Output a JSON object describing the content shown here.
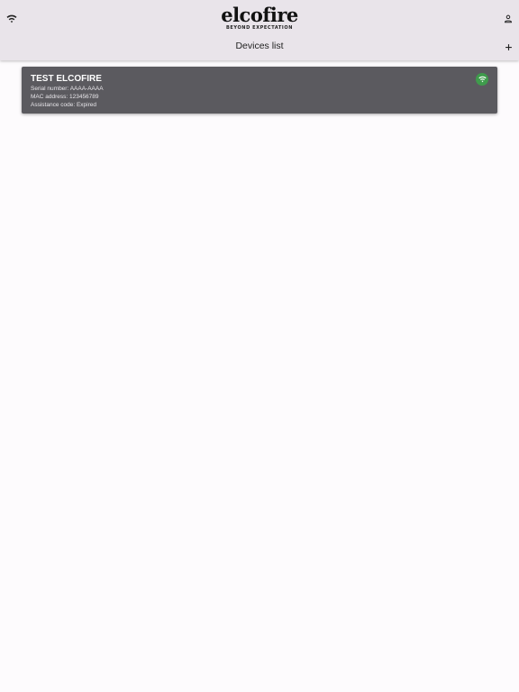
{
  "header": {
    "logo_text": "elcofire",
    "logo_tagline": "BEYOND EXPECTATION",
    "page_title": "Devices list",
    "icons": {
      "left": "wifi-icon",
      "right": "person-icon",
      "action": "plus-icon"
    }
  },
  "devices": [
    {
      "name": "TEST ELCOFIRE",
      "serial": "Serial number: AAAA-AAAA",
      "mac": "MAC address: 123456789",
      "assistance": "Assistance code: Expired",
      "status_icon": "wifi-connected-icon",
      "status_color": "#3f9b4c"
    }
  ],
  "colors": {
    "app_bar": "#e9e4ea",
    "card": "#5b5a5f",
    "background": "#fdfbfd"
  }
}
